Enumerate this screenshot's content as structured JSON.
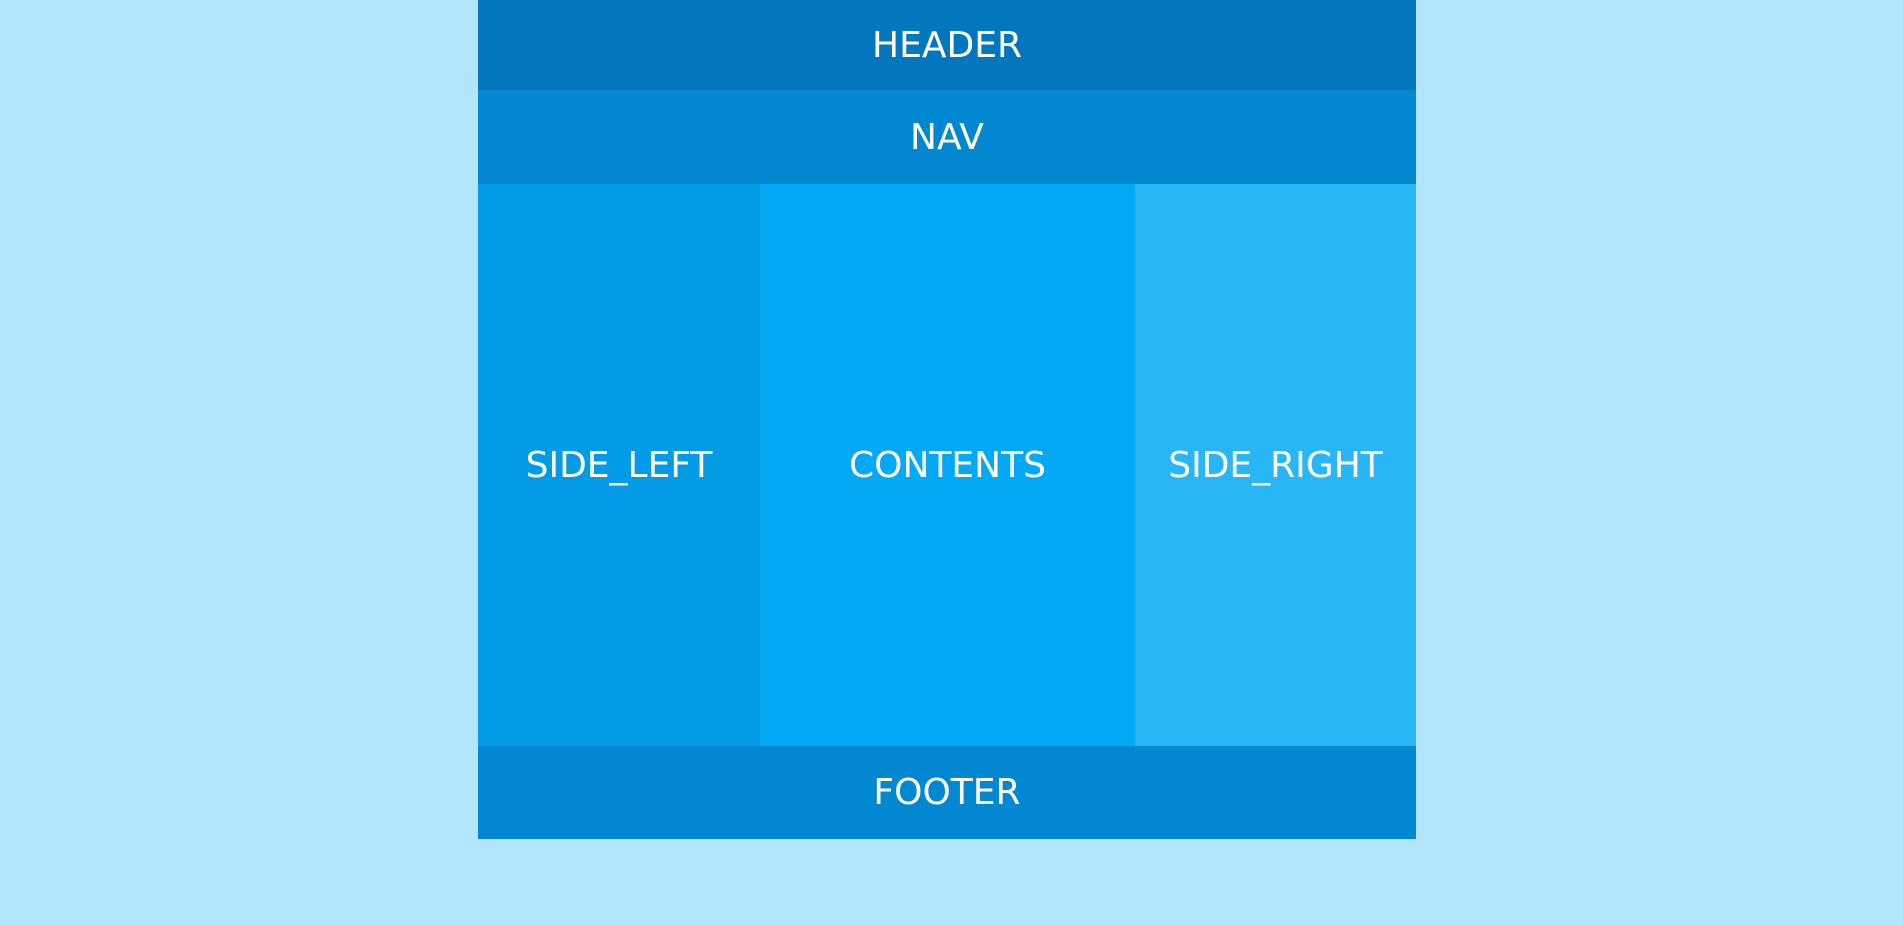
{
  "layout": {
    "header": "HEADER",
    "nav": "NAV",
    "side_left": "SIDE_LEFT",
    "contents": "CONTENTS",
    "side_right": "SIDE_RIGHT",
    "footer": "FOOTER"
  },
  "colors": {
    "background": "#b3e5fc",
    "header": "#0277bd",
    "nav": "#0288d1",
    "side_left": "#039be5",
    "contents": "#03a9f4",
    "side_right": "#29b6f6",
    "footer": "#0288d1",
    "text": "#ffffff"
  }
}
